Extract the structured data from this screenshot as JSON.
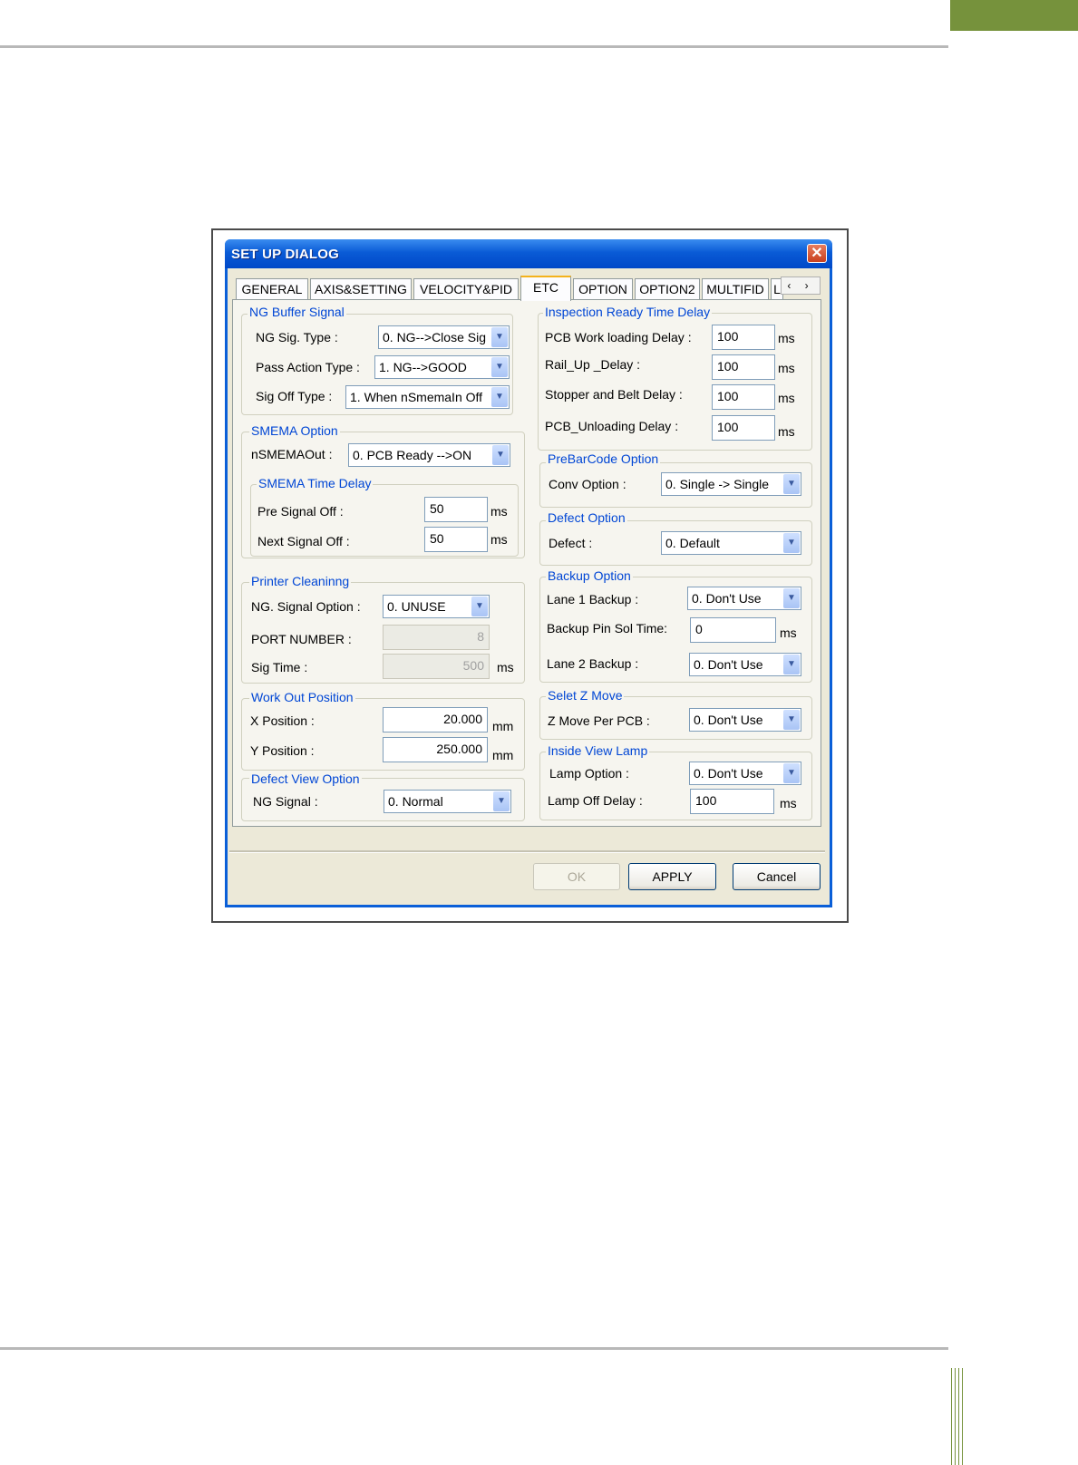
{
  "window": {
    "title": "SET UP DIALOG",
    "close_glyph": "✕"
  },
  "tabs": [
    {
      "label": "GENERAL"
    },
    {
      "label": "AXIS&SETTING"
    },
    {
      "label": "VELOCITY&PID"
    },
    {
      "label": "ETC",
      "active": true
    },
    {
      "label": "OPTION"
    },
    {
      "label": "OPTION2"
    },
    {
      "label": "MULTIFID"
    },
    {
      "label": "L"
    }
  ],
  "tab_scroll": "‹ ›",
  "ng_buffer": {
    "title": "NG Buffer Signal",
    "sig_type_label": "NG Sig. Type :",
    "sig_type_value": "0. NG-->Close Sig",
    "pass_action_label": "Pass Action Type :",
    "pass_action_value": "1. NG-->GOOD",
    "sig_off_label": "Sig Off Type :",
    "sig_off_value": "1. When nSmemaIn Off"
  },
  "smema": {
    "title": "SMEMA Option",
    "out_label": "nSMEMAOut :",
    "out_value": "0. PCB Ready -->ON",
    "time_delay_title": "SMEMA Time Delay",
    "pre_label": "Pre Signal Off :",
    "pre_value": "50",
    "pre_unit": "ms",
    "next_label": "Next Signal Off :",
    "next_value": "50",
    "next_unit": "ms"
  },
  "printer_cleaning": {
    "title": "Printer Cleaninng",
    "ng_option_label": "NG. Signal Option :",
    "ng_option_value": "0. UNUSE",
    "port_label": "PORT NUMBER :",
    "port_value": "8",
    "sig_time_label": "Sig Time :",
    "sig_time_value": "500",
    "sig_time_unit": "ms"
  },
  "work_out": {
    "title": "Work Out Position",
    "x_label": "X Position :",
    "x_value": "20.000",
    "x_unit": "mm",
    "y_label": "Y Position :",
    "y_value": "250.000",
    "y_unit": "mm"
  },
  "defect_view": {
    "title": "Defect View Option",
    "ng_label": "NG Signal :",
    "ng_value": "0. Normal"
  },
  "inspection_ready": {
    "title": "Inspection Ready Time Delay",
    "pcb_load_label": "PCB Work loading Delay :",
    "pcb_load_value": "100",
    "rail_up_label": "Rail_Up _Delay :",
    "rail_up_value": "100",
    "stopper_label": "Stopper and Belt Delay :",
    "stopper_value": "100",
    "unload_label": "PCB_Unloading Delay :",
    "unload_value": "100",
    "unit": "ms"
  },
  "prebarcode": {
    "title": "PreBarCode Option",
    "conv_label": "Conv Option :",
    "conv_value": "0. Single -> Single"
  },
  "defect_option": {
    "title": "Defect Option",
    "defect_label": "Defect :",
    "defect_value": "0. Default"
  },
  "backup": {
    "title": "Backup Option",
    "lane1_label": "Lane 1 Backup :",
    "lane1_value": "0. Don't Use",
    "pin_sol_label": "Backup Pin Sol Time:",
    "pin_sol_value": "0",
    "pin_sol_unit": "ms",
    "lane2_label": "Lane 2 Backup :",
    "lane2_value": "0. Don't Use"
  },
  "z_move": {
    "title": "Selet Z Move",
    "per_pcb_label": "Z Move Per PCB :",
    "per_pcb_value": "0. Don't Use"
  },
  "inside_lamp": {
    "title": "Inside View Lamp",
    "lamp_option_label": "Lamp Option :",
    "lamp_option_value": "0. Don't Use",
    "lamp_off_label": "Lamp Off Delay :",
    "lamp_off_value": "100",
    "lamp_off_unit": "ms"
  },
  "buttons": {
    "ok": "OK",
    "apply": "APPLY",
    "cancel": "Cancel"
  },
  "colors": {
    "accent_green": "#76923c",
    "title_blue": "#0a5bd6",
    "group_title": "#0046d5"
  }
}
